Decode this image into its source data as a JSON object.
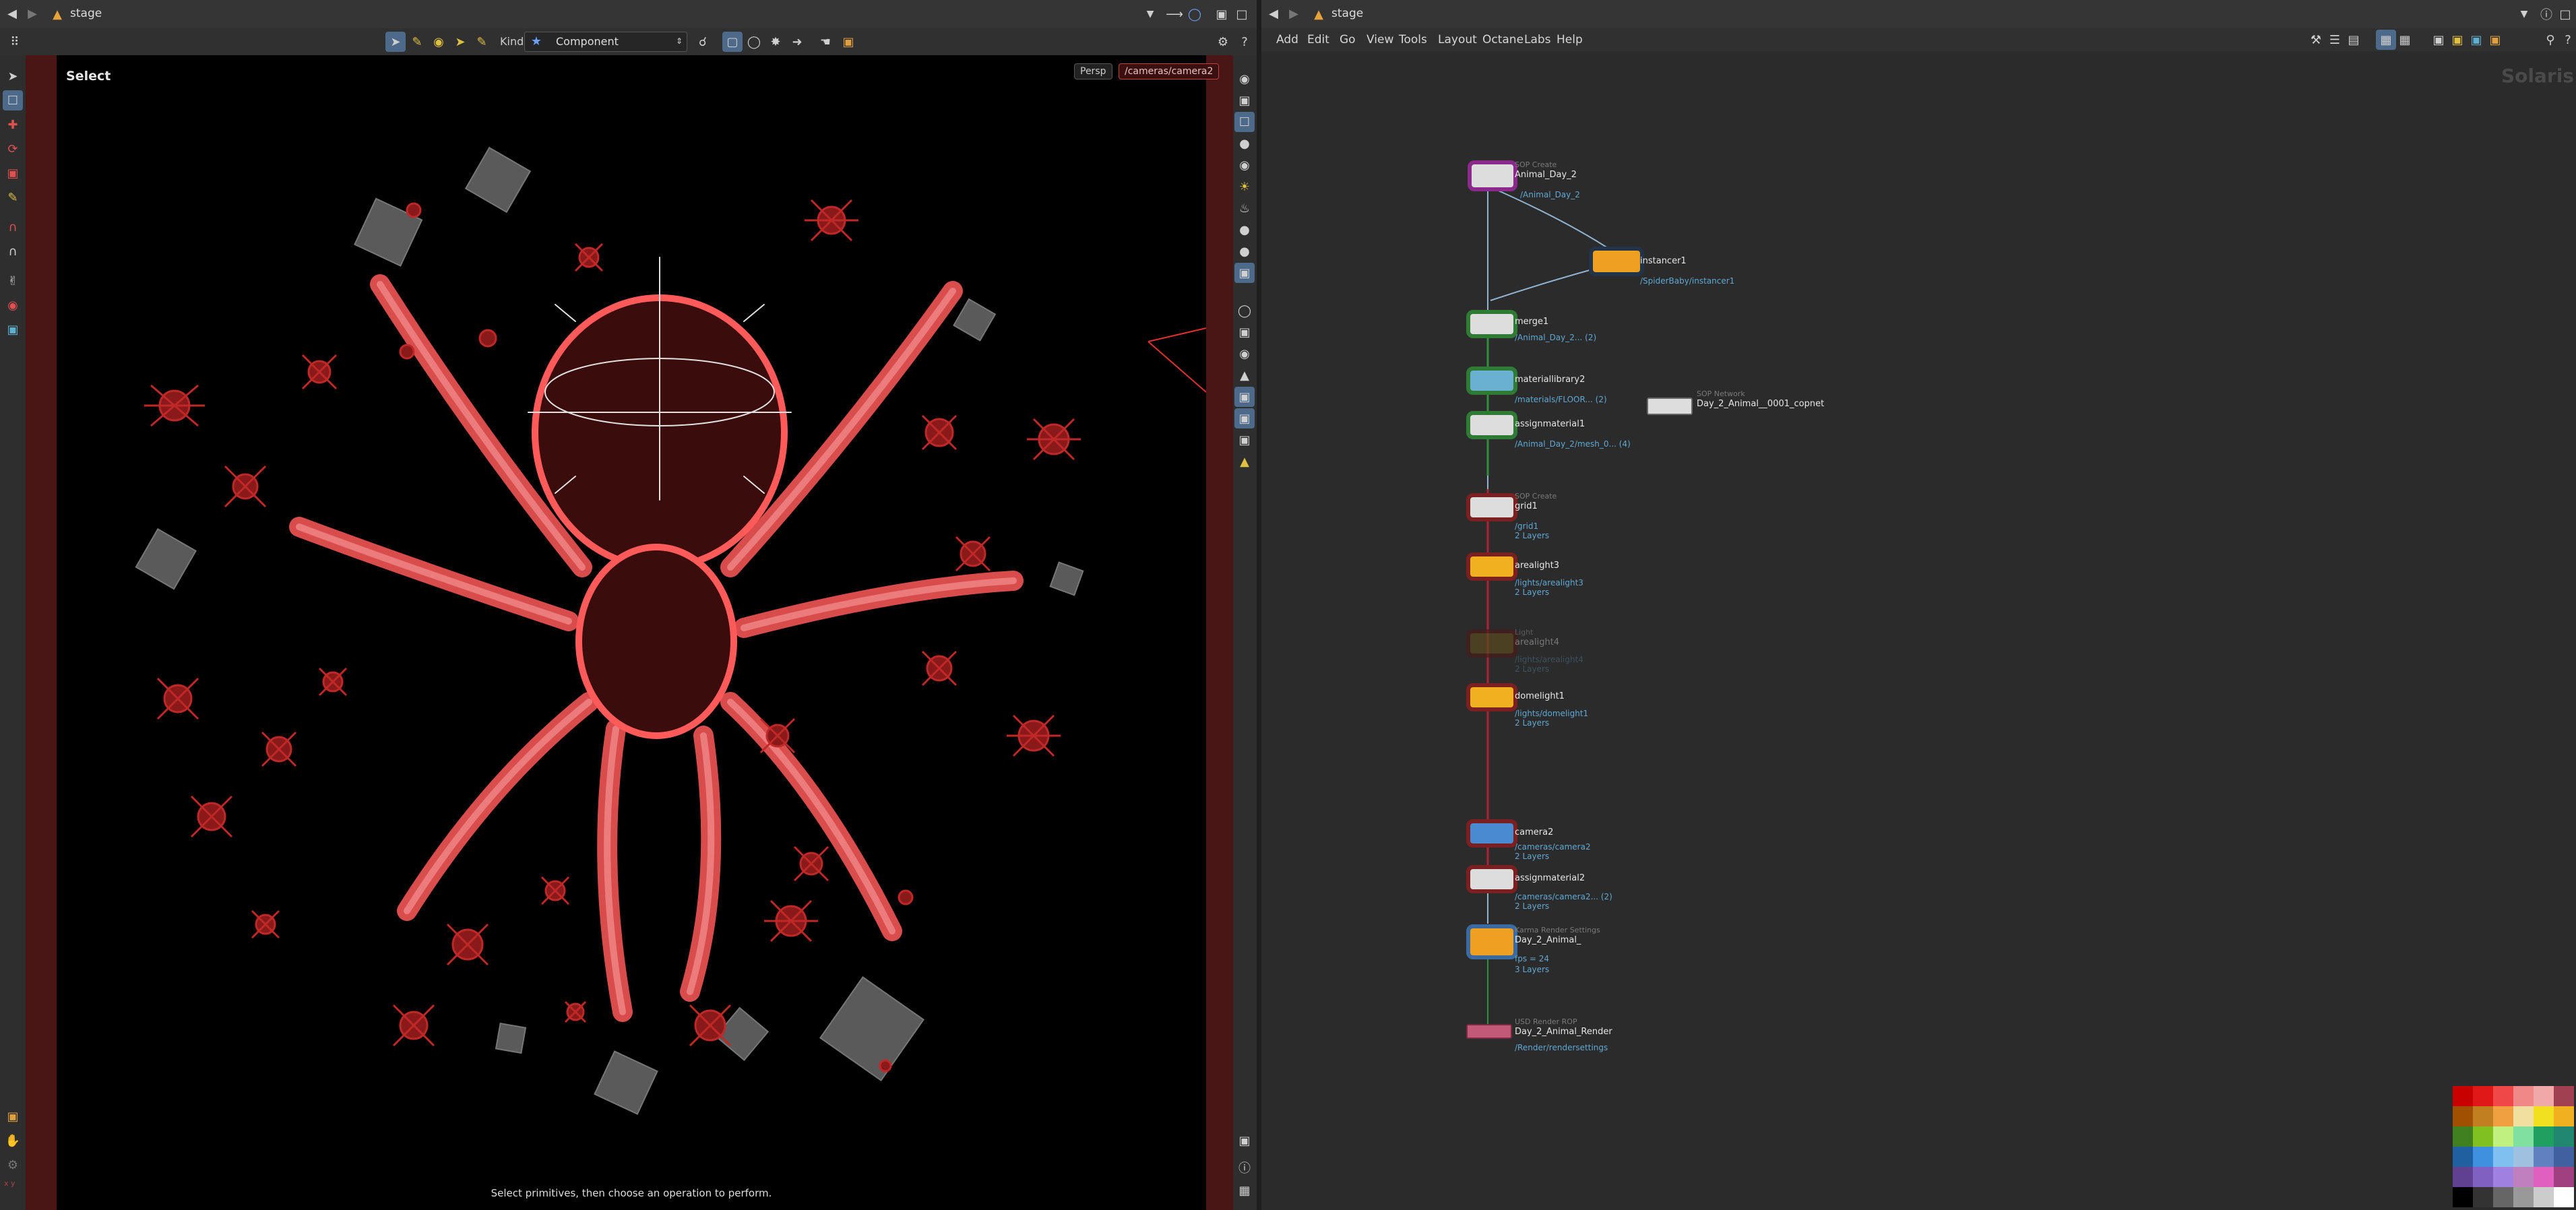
{
  "left_pane": {
    "tab_title": "stage",
    "kind_label": "Kind",
    "kind_value": "Component",
    "viewport_title": "Select",
    "persp_label": "Persp",
    "camera_label": "/cameras/camera2",
    "status_hint": "Select primitives, then choose an operation to perform.",
    "axis_label": "x y"
  },
  "right_pane": {
    "tab_title": "stage",
    "menu": [
      "Add",
      "Edit",
      "Go",
      "View",
      "Tools",
      "Layout",
      "Octane",
      "Labs",
      "Help"
    ],
    "context_label": "Solaris"
  },
  "nodes": [
    {
      "type": "SOP Create",
      "name": "Animal_Day_2",
      "info1": "/Animal_Day_2",
      "info2": ""
    },
    {
      "type": "",
      "name": "instancer1",
      "info1": "/SpiderBaby/instancer1",
      "info2": ""
    },
    {
      "type": "",
      "name": "merge1",
      "info1": "/Animal_Day_2... (2)",
      "info2": ""
    },
    {
      "type": "",
      "name": "materiallibrary2",
      "info1": "/materials/FLOOR... (2)",
      "info2": ""
    },
    {
      "type": "",
      "name": "assignmaterial1",
      "info1": "/Animal_Day_2/mesh_0... (4)",
      "info2": ""
    },
    {
      "type": "SOP Create",
      "name": "grid1",
      "info1": "/grid1",
      "info2": "2 Layers"
    },
    {
      "type": "Light",
      "name": "arealight3",
      "info1": "/lights/arealight3",
      "info2": "2 Layers"
    },
    {
      "type": "Light",
      "name": "arealight4",
      "info1": "/lights/arealight4",
      "info2": "2 Layers"
    },
    {
      "type": "",
      "name": "domelight1",
      "info1": "/lights/domelight1",
      "info2": "2 Layers"
    },
    {
      "type": "",
      "name": "camera2",
      "info1": "/cameras/camera2",
      "info2": "2 Layers"
    },
    {
      "type": "",
      "name": "assignmaterial2",
      "info1": "/cameras/camera2... (2)",
      "info2": "2 Layers"
    },
    {
      "type": "Karma Render Settings",
      "name": "Day_2_Animal_",
      "info1": "fps = 24",
      "info2": "3 Layers"
    },
    {
      "type": "USD Render ROP",
      "name": "Day_2_Animal_Render",
      "info1": "/Render/rendersettings",
      "info2": ""
    },
    {
      "type": "SOP Network",
      "name": "Day_2_Animal__0001_copnet",
      "info1": "",
      "info2": ""
    }
  ],
  "colors": {
    "viewport_bg": "#000000",
    "viewport_border": "#4a1515",
    "spider": "#ff5555",
    "wire": "#8fb3d0",
    "wire_red": "#b0223a",
    "info_text": "#5fa8d3"
  }
}
